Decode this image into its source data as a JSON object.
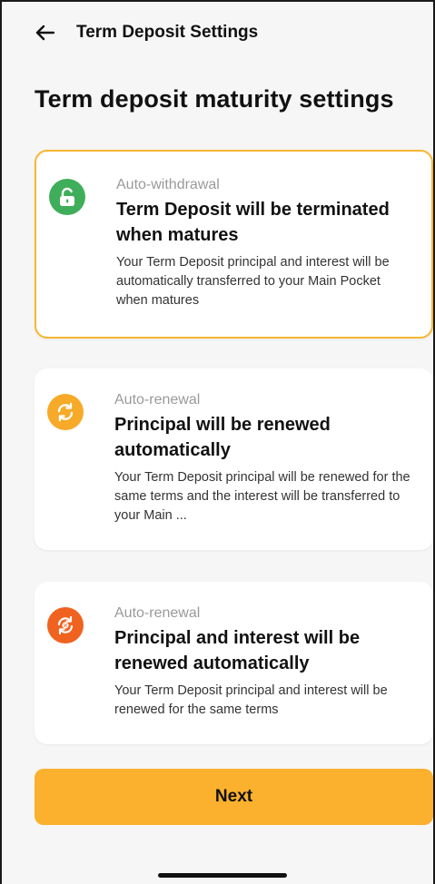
{
  "header": {
    "title": "Term Deposit Settings"
  },
  "page": {
    "title": "Term deposit maturity settings"
  },
  "options": [
    {
      "kind": "Auto-withdrawal",
      "headline": "Term Deposit will be terminated when matures",
      "description": "Your Term Deposit principal and interest will be automatically transferred to your Main Pocket when matures",
      "icon": "unlock-icon",
      "color": "#3fae5a",
      "selected": true
    },
    {
      "kind": "Auto-renewal",
      "headline": "Principal will be renewed automatically",
      "description": "Your Term Deposit principal will be renewed for the same terms and the interest will be transferred to your Main ...",
      "icon": "renew-icon",
      "color": "#f7a928",
      "selected": false
    },
    {
      "kind": "Auto-renewal",
      "headline": "Principal and interest will be renewed automatically",
      "description": "Your Term Deposit principal and interest will be renewed for the same terms",
      "icon": "renew-percent-icon",
      "color": "#f0621f",
      "selected": false
    }
  ],
  "actions": {
    "next_label": "Next"
  },
  "colors": {
    "accent": "#fbb12e",
    "selected_border": "#f7b731"
  }
}
